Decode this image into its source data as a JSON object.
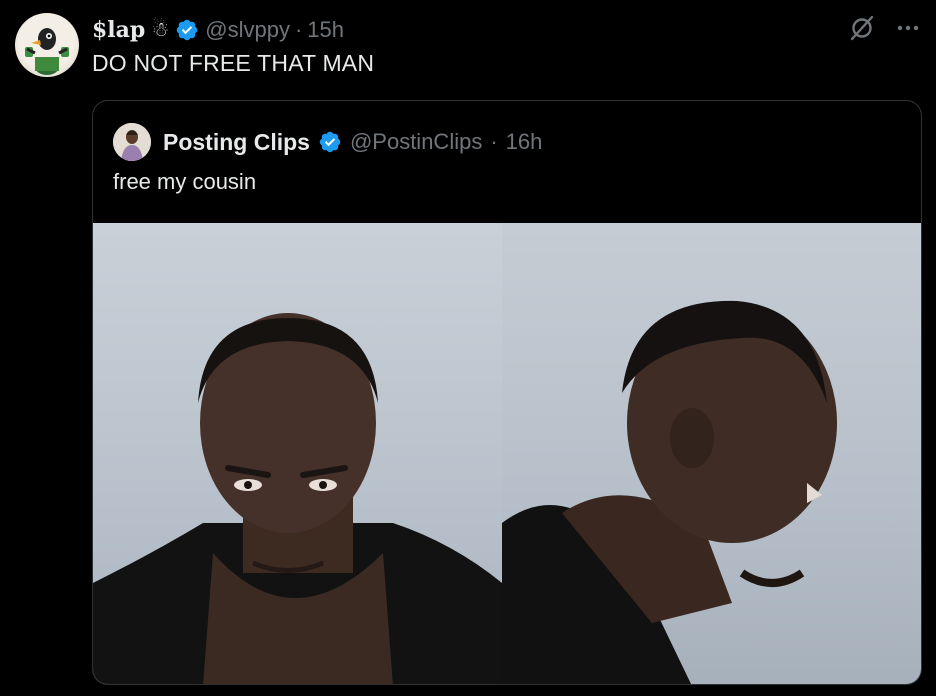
{
  "post": {
    "display_name": "$lap",
    "name_emoji": "☃",
    "handle": "@slvppy",
    "separator": "·",
    "time": "15h",
    "text": "DO NOT FREE THAT MAN",
    "verified": true
  },
  "quoted": {
    "display_name": "Posting Clips",
    "handle": "@PostinClips",
    "separator": "·",
    "time": "16h",
    "text": "free my cousin",
    "verified": true
  },
  "icons": {
    "verified": "verified-badge-icon",
    "grok": "grok-icon",
    "more": "more-icon"
  },
  "colors": {
    "background": "#000000",
    "text_primary": "#e7e9ea",
    "text_secondary": "#71767b",
    "verified_blue": "#1d9bf0",
    "border": "#2f3336"
  }
}
